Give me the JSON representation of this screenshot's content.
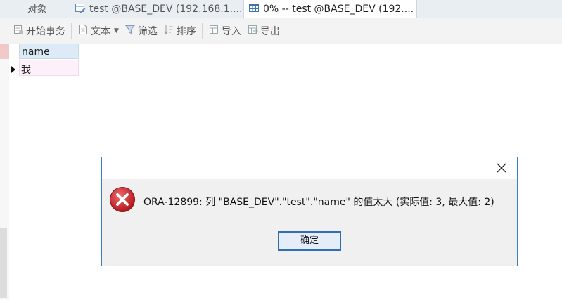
{
  "tabs": [
    {
      "label": "对象",
      "icon": "none"
    },
    {
      "label": "test @BASE_DEV (192.168.1....",
      "icon": "table-design-icon"
    },
    {
      "label": "0% -- test @BASE_DEV (192....",
      "icon": "table-grid-icon",
      "active": true
    }
  ],
  "toolbar": {
    "begin_transaction": "开始事务",
    "text": "文本",
    "filter": "筛选",
    "sort": "排序",
    "import": "导入",
    "export": "导出"
  },
  "grid": {
    "column_header": "name",
    "cell_value": "我"
  },
  "dialog": {
    "message": "ORA-12899: 列 \"BASE_DEV\".\"test\".\"name\" 的值太大 (实际值: 3, 最大值: 2)",
    "ok_label": "确定",
    "border_color": "#3c7fbf",
    "error_color": "#c8252c"
  }
}
